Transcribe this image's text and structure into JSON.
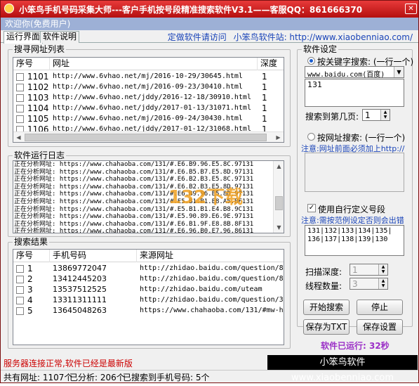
{
  "window": {
    "title": "小笨鸟手机号码采集大师---客户手机按号段精准搜索软件V3.1——客服QQ：861666370"
  },
  "welcome": "欢迎你(免费用户)",
  "tabs": [
    "运行界面",
    "软件说明"
  ],
  "links": {
    "custom": "定做软件请访问",
    "site": "小笨鸟软件站: http://www.xiaobenniao.com/"
  },
  "search_list": {
    "title": "搜寻网址列表",
    "columns": [
      "序号",
      "网址",
      "深度"
    ],
    "rows": [
      {
        "id": "1101",
        "url": "http://www.6vhao.net/mj/2016-10-29/30645.html",
        "depth": "1"
      },
      {
        "id": "1102",
        "url": "http://www.6vhao.net/mj/2016-09-23/30410.html",
        "depth": "1"
      },
      {
        "id": "1103",
        "url": "http://www.6vhao.net/jddy/2016-12-18/30910.html",
        "depth": "1"
      },
      {
        "id": "1104",
        "url": "http://www.6vhao.net/jddy/2017-01-13/31071.html",
        "depth": "1"
      },
      {
        "id": "1105",
        "url": "http://www.6vhao.net/mj/2016-09-24/30430.html",
        "depth": "1"
      },
      {
        "id": "1106",
        "url": "http://www.6vhao.net/jddy/2017-01-12/31068.html",
        "depth": "1"
      }
    ]
  },
  "log": {
    "title": "软件运行日志",
    "lines": [
      "正在分析网址: https://www.chahaoba.com/131/#.E6.B9.96.E5.8C.97131",
      "正在分析网址: https://www.chahaoba.com/131/#.E6.B5.B7.E5.8D.97131",
      "正在分析网址: https://www.chahaoba.com/131/#.E6.B2.B3.E5.8C.97131",
      "正在分析网址: https://www.chahaoba.com/131/#.E6.B2.B3.E5.8D.97131",
      "正在分析网址: https://www.chahaoba.com/131/#.E6.B9.96.E5.8D.97131",
      "正在分析网址: https://www.chahaoba.com/131/#.E5.B1.B1.E8.A5.BF131",
      "正在分析网址: https://www.chahaoba.com/131/#.E5.B1.B1.E4.B8.9C131",
      "正在分析网址: https://www.chahaoba.com/131/#.E5.90.89.E6.9E.97131",
      "正在分析网址: https://www.chahaoba.com/131/#.E6.B1.9F.E8.8B.8F131",
      "正在分析网址: https://www.chahaoba.com/131/#.E6.96.B0.E7.96.86131",
      "正在分析网址: https://www.chahaoba.com/131/#.E9.9D.92.E6.B5.B7131"
    ]
  },
  "results": {
    "title": "搜索结果",
    "columns": [
      "序号",
      "手机号码",
      "来源网址"
    ],
    "rows": [
      {
        "id": "1",
        "phone": "13869772047",
        "src": "http://zhidao.baidu.com/question/84..."
      },
      {
        "id": "2",
        "phone": "13412445203",
        "src": "http://zhidao.baidu.com/question/84..."
      },
      {
        "id": "3",
        "phone": "13537512525",
        "src": "http://zhidao.baidu.com/uteam"
      },
      {
        "id": "4",
        "phone": "13311311111",
        "src": "http://zhidao.baidu.com/question/33..."
      },
      {
        "id": "5",
        "phone": "13645048263",
        "src": "https://www.chahaoba.com/131/#mw-head"
      }
    ]
  },
  "settings": {
    "title": "软件设定",
    "keyword_label": "按关键字搜索: (一行一个)",
    "engine": "www.baidu.com(百度)",
    "keyword": "131",
    "page_label": "搜索到第几页:",
    "page": "1",
    "url_label": "按网址搜索: (一行一个)",
    "url_note": "注意:网址前面必须加上http://",
    "segment_check": "使用自行定义号段",
    "segment_note": "注意:需按范例设定否则会出错",
    "segments": [
      "131|132|133|134|135|",
      "136|137|138|139|130"
    ],
    "depth_label": "扫描深度:",
    "depth": "1",
    "threads_label": "线程数量:",
    "threads": "3"
  },
  "buttons": {
    "start": "开始搜索",
    "stop": "停止",
    "save_txt": "保存为TXT",
    "save_settings": "保存设置"
  },
  "runtime": "软件已运行: 32秒",
  "server_status": "服务器连接正常,软件已经是最新版",
  "banner": "小笨鸟软件 www.xiaobenniao.com",
  "status": {
    "total": "共有网址: 1107个",
    "analyzed": "已分析: 206个",
    "found": "已搜索到手机号码: 5个"
  },
  "watermark": {
    "text": "132下载站",
    "sub": "C"
  },
  "colors": {
    "title": "#c8191b",
    "accent_blue": "#1a44b8",
    "warning_red": "#cc0000",
    "runtime_purple": "#9b2fc7"
  }
}
